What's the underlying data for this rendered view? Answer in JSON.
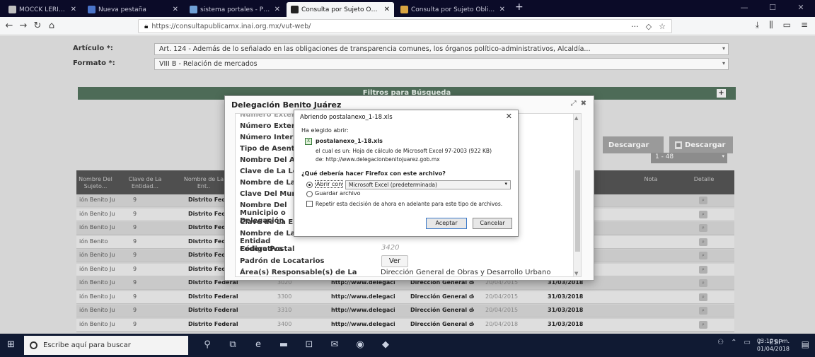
{
  "browser": {
    "tabs": [
      {
        "title": "MOCCK LERIVENE MUSEUM",
        "icon_color": "#c0c0c0",
        "active": false
      },
      {
        "title": "Nueva pestaña",
        "icon_color": "#4a74c9",
        "active": false
      },
      {
        "title": "sistema portales - PNT",
        "icon_color": "#6fa0d6",
        "active": false
      },
      {
        "title": "Consulta por Sujeto Obligado",
        "icon_color": "#222222",
        "active": true
      },
      {
        "title": "Consulta por Sujeto Obligado",
        "icon_color": "#d9a441",
        "active": false
      }
    ],
    "new_tab": "+",
    "url": "https://consultapublicamx.inai.org.mx/vut-web/",
    "window_controls": [
      "—",
      "☐",
      "✕"
    ]
  },
  "form": {
    "articulo_label": "Artículo *:",
    "articulo_value": "Art. 124 - Además de lo señalado en las obligaciones de transparencia comunes, los órganos político-administrativos, Alcaldía...",
    "formato_label": "Formato *:",
    "formato_value": "VIII B - Relación de mercados"
  },
  "filters_bar": {
    "title": "Filtros para Búsqueda",
    "toggle": "+"
  },
  "download_buttons": [
    {
      "label": "Descargar"
    },
    {
      "label": "Descargar"
    }
  ],
  "pager": {
    "value": "1 - 48"
  },
  "table": {
    "headers": [
      "Nombre Del Sujeto...",
      "Clave de La Entidad...",
      "Nombre de La Ent..",
      "",
      "",
      "",
      "",
      "",
      "",
      "Nota",
      "Detalle"
    ],
    "rows": [
      {
        "c1": "ión Benito Ju...",
        "c2": "9",
        "c3": "Distrito Federal",
        "c4": "",
        "c5": "",
        "c6": "",
        "c7": "",
        "c8": ""
      },
      {
        "c1": "ión Benito Ju...",
        "c2": "9",
        "c3": "Distrito Federal",
        "c4": "",
        "c5": "",
        "c6": "",
        "c7": "",
        "c8": ""
      },
      {
        "c1": "ión Benito Ju...",
        "c2": "9",
        "c3": "Distrito Federal",
        "c4": "",
        "c5": "",
        "c6": "",
        "c7": "",
        "c8": ""
      },
      {
        "c1": "ión Benito",
        "c2": "9",
        "c3": "Distrito Federal",
        "c4": "",
        "c5": "",
        "c6": "",
        "c7": "",
        "c8": ""
      },
      {
        "c1": "ión Benito Ju...",
        "c2": "9",
        "c3": "Distrito Federal",
        "c4": "",
        "c5": "",
        "c6": "",
        "c7": "",
        "c8": ""
      },
      {
        "c1": "ión Benito Ju...",
        "c2": "9",
        "c3": "Distrito Federal",
        "c4": "",
        "c5": "",
        "c6": "",
        "c7": "",
        "c8": ""
      },
      {
        "c1": "ión Benito Ju...",
        "c2": "9",
        "c3": "Distrito Federal",
        "c4": "3020",
        "c5": "http://www.delegacio..",
        "c6": "Dirección General de...",
        "c7": "20/04/2015",
        "c8": "31/03/2018"
      },
      {
        "c1": "ión Benito Ju...",
        "c2": "9",
        "c3": "Distrito Federal",
        "c4": "3300",
        "c5": "http://www.delegacio..",
        "c6": "Dirección General de...",
        "c7": "20/04/2015",
        "c8": "31/03/2018"
      },
      {
        "c1": "ión Benito Ju...",
        "c2": "9",
        "c3": "Distrito Federal",
        "c4": "3310",
        "c5": "http://www.delegacio..",
        "c6": "Dirección General de...",
        "c7": "20/04/2015",
        "c8": "31/03/2018"
      },
      {
        "c1": "ión Benito Ju...",
        "c2": "9",
        "c3": "Distrito Federal",
        "c4": "3400",
        "c5": "http://www.delegacio..",
        "c6": "Dirección General de...",
        "c7": "20/04/2018",
        "c8": "31/03/2018"
      }
    ]
  },
  "modal": {
    "title": "Delegación Benito Juárez",
    "controls": [
      "⤢",
      "✖"
    ],
    "labels": [
      "Número Exterior",
      "Número Interior",
      "Tipo de Asentamiento",
      "Nombre Del Asentamiento",
      "Clave de La Localidad",
      "Nombre de La Localidad",
      "Clave Del Municipio",
      "Nombre Del Municipio o Delegación",
      "Clave de La Entidad",
      "Nombre de La Entidad Federativa",
      "Código Postal",
      "Padrón de Locatarios",
      "Área(s) Responsable(s) de La Información"
    ],
    "codigo_postal_value": "3420",
    "ver_button": "Ver",
    "area_value": "Dirección General de Obras y Desarrollo Urbano"
  },
  "download_dialog": {
    "title": "Abriendo postalanexo_1-18.xls",
    "chosen_label": "Ha elegido abrir:",
    "filename": "postalanexo_1-18.xls",
    "file_icon": "X",
    "type_line": "el cual es un: Hoja de cálculo de Microsoft Excel 97-2003 (922 KB)",
    "from_line": "de: http://www.delegacionbenitojuarez.gob.mx",
    "question": "¿Qué debería hacer Firefox con este archivo?",
    "open_with_label": "Abrir con",
    "open_with_app": "Microsoft Excel (predeterminada)",
    "save_label": "Guardar archivo",
    "remember_label": "Repetir esta decisión de ahora en adelante para este tipo de archivos.",
    "accept": "Aceptar",
    "cancel": "Cancelar",
    "close": "✕"
  },
  "taskbar": {
    "search_placeholder": "Escribe aquí para buscar",
    "language": "ESP",
    "time": "03:10 p. m.",
    "date": "01/04/2018"
  }
}
